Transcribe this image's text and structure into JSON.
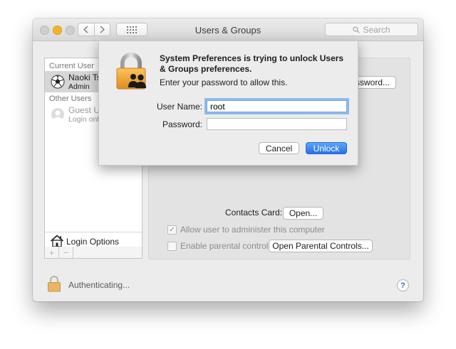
{
  "window": {
    "title": "Users & Groups"
  },
  "toolbar": {
    "back_icon": "chevron-left-icon",
    "forward_icon": "chevron-right-icon",
    "grid_icon": "show-all-grid-icon",
    "search_placeholder": "Search"
  },
  "sidebar": {
    "current_user_label": "Current User",
    "current_user": {
      "name": "Naoki Ts",
      "role": "Admin"
    },
    "other_users_label": "Other Users",
    "other_users": [
      {
        "name": "Guest Us",
        "sub": "Login only"
      }
    ],
    "login_options_label": "Login Options",
    "add_label": "+",
    "remove_label": "−"
  },
  "main": {
    "password_button_label": "ssword...",
    "contacts_card_label": "Contacts Card:",
    "open_button_label": "Open...",
    "allow_admin_label": "Allow user to administer this computer",
    "allow_admin_checked": true,
    "parental_label": "Enable parental controls",
    "parental_checked": false,
    "open_parental_label": "Open Parental Controls..."
  },
  "footer": {
    "status": "Authenticating...",
    "help_label": "?"
  },
  "dialog": {
    "title": "System Preferences is trying to unlock Users & Groups preferences.",
    "message": "Enter your password to allow this.",
    "username_label": "User Name:",
    "username_value": "root",
    "password_label": "Password:",
    "password_value": "",
    "cancel_label": "Cancel",
    "unlock_label": "Unlock"
  },
  "colors": {
    "accent": "#2670e8",
    "lock_gold": "#f0a23a",
    "focus_ring": "#8db9ee"
  }
}
